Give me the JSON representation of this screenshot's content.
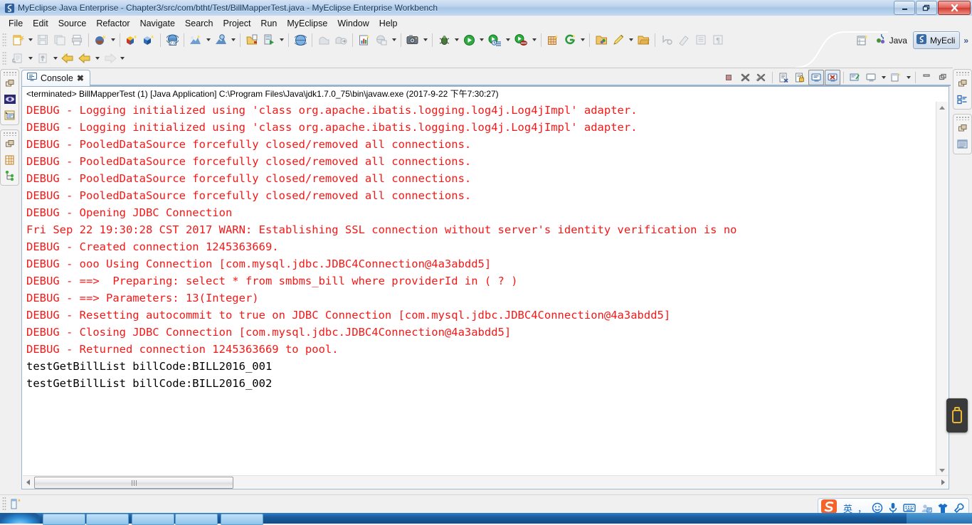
{
  "window": {
    "title": "MyEclipse Java Enterprise - Chapter3/src/com/btht/Test/BillMapperTest.java - MyEclipse Enterprise Workbench",
    "app_icon": "myeclipse-icon",
    "minimize_label": "—",
    "maximize_label": "❐",
    "close_label": "✕"
  },
  "menubar": {
    "items": [
      {
        "label": "File"
      },
      {
        "label": "Edit"
      },
      {
        "label": "Source"
      },
      {
        "label": "Refactor"
      },
      {
        "label": "Navigate"
      },
      {
        "label": "Search"
      },
      {
        "label": "Project"
      },
      {
        "label": "Run"
      },
      {
        "label": "MyEclipse"
      },
      {
        "label": "Window"
      },
      {
        "label": "Help"
      }
    ]
  },
  "toolbar": {
    "row1": [
      {
        "icon": "new-wizard-icon",
        "dropdown": true
      },
      {
        "icon": "save-icon",
        "dropdown": false
      },
      {
        "icon": "save-all-icon",
        "dropdown": false
      },
      {
        "icon": "print-icon",
        "dropdown": false
      },
      {
        "sep": true
      },
      {
        "icon": "deploy-myeclipse-icon",
        "dropdown": true
      },
      {
        "sep": true
      },
      {
        "icon": "open-database-explorer-icon",
        "dropdown": false
      },
      {
        "icon": "open-blue-cube-icon",
        "dropdown": false
      },
      {
        "sep": true
      },
      {
        "icon": "web-2.0-icon",
        "dropdown": false
      },
      {
        "sep": true
      },
      {
        "icon": "new-server-wizard-icon",
        "dropdown": true
      },
      {
        "icon": "manage-deployments-icon",
        "dropdown": true
      },
      {
        "sep": true
      },
      {
        "icon": "open-type-icon",
        "dropdown": false
      },
      {
        "icon": "run-server-icon",
        "dropdown": true
      },
      {
        "sep": true
      },
      {
        "icon": "globe-browser-icon",
        "dropdown": false
      },
      {
        "sep": true
      },
      {
        "icon": "package-icon",
        "dropdown": false
      },
      {
        "icon": "export-icon",
        "dropdown": false
      },
      {
        "sep": true
      },
      {
        "icon": "report-icon",
        "dropdown": false
      },
      {
        "icon": "globe-report-icon",
        "dropdown": true
      },
      {
        "sep": true
      },
      {
        "icon": "snapshot-camera-icon",
        "dropdown": true
      },
      {
        "sep": true
      },
      {
        "icon": "debug-bug-icon",
        "dropdown": true
      },
      {
        "icon": "run-play-icon",
        "dropdown": true
      },
      {
        "icon": "run-history-icon",
        "dropdown": true
      },
      {
        "icon": "run-coverage-icon",
        "dropdown": true
      },
      {
        "sep": true
      },
      {
        "icon": "new-table-icon",
        "dropdown": false
      },
      {
        "icon": "new-generate-icon",
        "dropdown": true
      },
      {
        "sep": true
      },
      {
        "icon": "open-folder-icon",
        "dropdown": false
      },
      {
        "icon": "pencil-edit-icon",
        "dropdown": true
      },
      {
        "icon": "open-folder-2-icon",
        "dropdown": false
      },
      {
        "sep": true
      },
      {
        "icon": "next-annotation-icon",
        "dropdown": false
      },
      {
        "icon": "previous-annotation-icon",
        "dropdown": false
      },
      {
        "icon": "toggle-block-selection-icon",
        "dropdown": false
      },
      {
        "icon": "show-whitespace-icon",
        "dropdown": false
      }
    ],
    "row2": [
      {
        "icon": "import-icon",
        "dropdown": true
      },
      {
        "icon": "export-file-icon",
        "dropdown": true
      },
      {
        "icon": "back-history-icon",
        "dropdown": false
      },
      {
        "icon": "back-arrow-icon",
        "dropdown": true
      },
      {
        "icon": "forward-arrow-icon",
        "dropdown": true
      }
    ],
    "perspectives": {
      "open_perspective_icon": "open-perspective-icon",
      "items": [
        {
          "label": "Java",
          "icon": "java-perspective-icon",
          "active": false
        },
        {
          "label": "MyEcli",
          "icon": "myeclipse-perspective-icon",
          "active": true
        }
      ],
      "more_label": "»"
    }
  },
  "fastview": {
    "left_groups": [
      {
        "buttons": [
          {
            "icon": "restore-view-icon"
          },
          {
            "icon": "myeclipse-explorer-icon"
          },
          {
            "icon": "outline-view-icon"
          }
        ]
      },
      {
        "buttons": [
          {
            "icon": "restore-view-icon"
          },
          {
            "icon": "servers-view-icon"
          },
          {
            "icon": "hierarchy-view-icon"
          }
        ]
      }
    ],
    "right_groups": [
      {
        "buttons": [
          {
            "icon": "restore-view-icon"
          },
          {
            "icon": "outline-tree-icon"
          }
        ]
      },
      {
        "buttons": [
          {
            "icon": "restore-view-icon"
          },
          {
            "icon": "task-list-icon"
          }
        ]
      }
    ]
  },
  "console": {
    "tab": {
      "label": "Console",
      "icon": "console-icon",
      "close_label": "✖"
    },
    "view_toolbar": [
      {
        "icon": "terminate-icon",
        "toggled": false
      },
      {
        "icon": "remove-launch-icon",
        "toggled": false
      },
      {
        "icon": "remove-all-terminated-icon",
        "toggled": false
      },
      {
        "sep": true
      },
      {
        "icon": "clear-console-icon",
        "toggled": false
      },
      {
        "icon": "scroll-lock-icon",
        "toggled": false
      },
      {
        "icon": "show-console-on-output-icon",
        "toggled": true
      },
      {
        "icon": "show-console-on-error-icon",
        "toggled": true
      },
      {
        "sep": true
      },
      {
        "icon": "pin-console-icon",
        "toggled": false
      },
      {
        "icon": "display-selected-console-icon",
        "toggled": false,
        "dropdown": true
      },
      {
        "icon": "open-console-icon",
        "toggled": false,
        "dropdown": true
      },
      {
        "sep": true
      },
      {
        "icon": "minimize-view-icon",
        "toggled": false
      },
      {
        "icon": "maximize-view-icon",
        "toggled": false
      }
    ],
    "launch_line": "<terminated> BillMapperTest (1) [Java Application] C:\\Program Files\\Java\\jdk1.7.0_75\\bin\\javaw.exe (2017-9-22 下午7:30:27)",
    "lines": [
      {
        "text": "DEBUG - Logging initialized using 'class org.apache.ibatis.logging.log4j.Log4jImpl' adapter.",
        "stream": "error"
      },
      {
        "text": "DEBUG - Logging initialized using 'class org.apache.ibatis.logging.log4j.Log4jImpl' adapter.",
        "stream": "error"
      },
      {
        "text": "DEBUG - PooledDataSource forcefully closed/removed all connections.",
        "stream": "error"
      },
      {
        "text": "DEBUG - PooledDataSource forcefully closed/removed all connections.",
        "stream": "error"
      },
      {
        "text": "DEBUG - PooledDataSource forcefully closed/removed all connections.",
        "stream": "error"
      },
      {
        "text": "DEBUG - PooledDataSource forcefully closed/removed all connections.",
        "stream": "error"
      },
      {
        "text": "DEBUG - Opening JDBC Connection",
        "stream": "error"
      },
      {
        "text": "Fri Sep 22 19:30:28 CST 2017 WARN: Establishing SSL connection without server's identity verification is no",
        "stream": "error"
      },
      {
        "text": "DEBUG - Created connection 1245363669.",
        "stream": "error"
      },
      {
        "text": "DEBUG - ooo Using Connection [com.mysql.jdbc.JDBC4Connection@4a3abdd5]",
        "stream": "error"
      },
      {
        "text": "DEBUG - ==>  Preparing: select * from smbms_bill where providerId in ( ? )",
        "stream": "error"
      },
      {
        "text": "DEBUG - ==> Parameters: 13(Integer)",
        "stream": "error"
      },
      {
        "text": "DEBUG - Resetting autocommit to true on JDBC Connection [com.mysql.jdbc.JDBC4Connection@4a3abdd5]",
        "stream": "error"
      },
      {
        "text": "DEBUG - Closing JDBC Connection [com.mysql.jdbc.JDBC4Connection@4a3abdd5]",
        "stream": "error"
      },
      {
        "text": "DEBUG - Returned connection 1245363669 to pool.",
        "stream": "error"
      },
      {
        "text": "testGetBillList billCode:BILL2016_001",
        "stream": "out"
      },
      {
        "text": "testGetBillList billCode:BILL2016_002",
        "stream": "out"
      }
    ]
  },
  "overlay": {
    "usb_icon": "usb-drive-icon"
  },
  "statusbar": {
    "icon": "smart-insert-icon"
  },
  "ime": {
    "logo": "sogou-logo-icon",
    "items": [
      {
        "icon": "chinese-english-icon",
        "label": "英"
      },
      {
        "icon": "comma-punctuation-icon",
        "label": "，"
      },
      {
        "icon": "emoji-icon",
        "label": ""
      },
      {
        "icon": "voice-input-icon",
        "label": ""
      },
      {
        "icon": "soft-keyboard-icon",
        "label": ""
      },
      {
        "icon": "user-account-icon",
        "label": ""
      },
      {
        "icon": "skin-icon",
        "label": ""
      },
      {
        "icon": "tools-wrench-icon",
        "label": ""
      }
    ]
  },
  "colors": {
    "console_error": "#f61717",
    "console_out": "#000000",
    "title_text": "#17365d",
    "accent": "#9ab4cf"
  }
}
